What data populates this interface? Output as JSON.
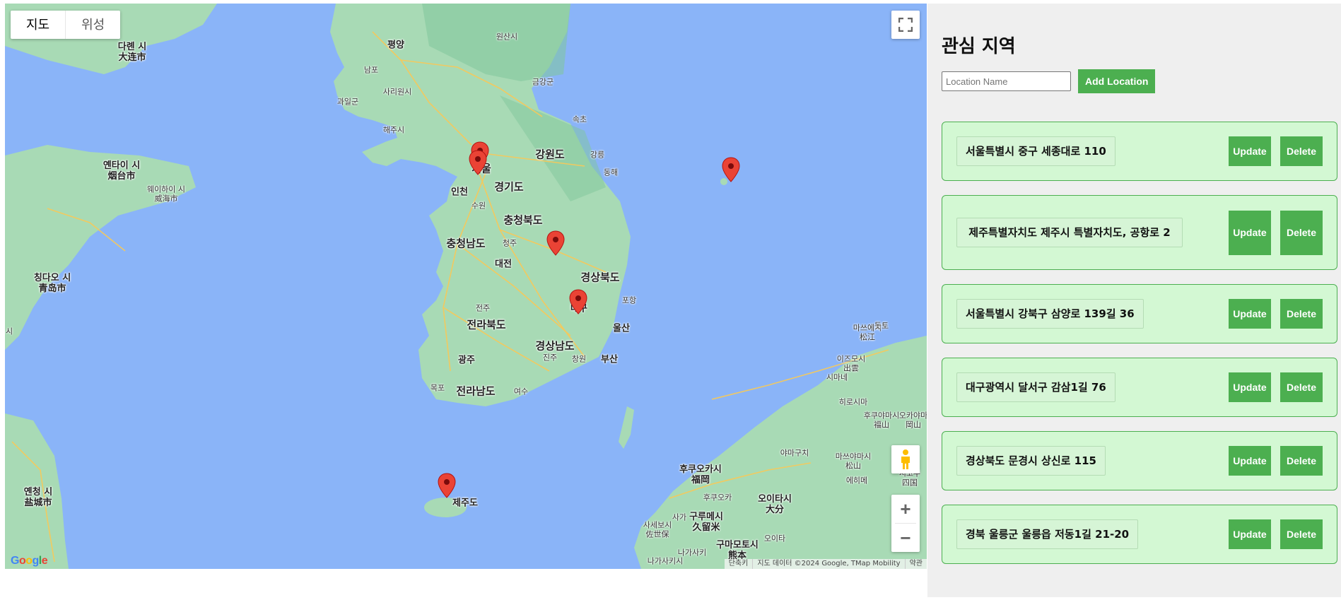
{
  "map": {
    "type_control": {
      "map_label": "지도",
      "satellite_label": "위성"
    },
    "places": [
      {
        "id": "pyongyang",
        "name": "평양"
      },
      {
        "id": "gangwon",
        "name": "강원도"
      },
      {
        "id": "gyeonggi",
        "name": "경기도"
      },
      {
        "id": "incheon",
        "name": "인천"
      },
      {
        "id": "suwon",
        "name": "수원"
      },
      {
        "id": "chungbuk",
        "name": "충청북도"
      },
      {
        "id": "chungnam",
        "name": "충청남도"
      },
      {
        "id": "cheongju",
        "name": "청주"
      },
      {
        "id": "daejeon",
        "name": "대전"
      },
      {
        "id": "gyeongbuk",
        "name": "경상북도"
      },
      {
        "id": "pohang",
        "name": "포항"
      },
      {
        "id": "jeonju",
        "name": "전주"
      },
      {
        "id": "jeonbuk",
        "name": "전라북도"
      },
      {
        "id": "ulsan",
        "name": "울산"
      },
      {
        "id": "gyeongnam",
        "name": "경상남도"
      },
      {
        "id": "jinju",
        "name": "진주"
      },
      {
        "id": "changwon",
        "name": "창원"
      },
      {
        "id": "busan",
        "name": "부산"
      },
      {
        "id": "gwangju",
        "name": "광주"
      },
      {
        "id": "mokpo",
        "name": "목포"
      },
      {
        "id": "jeonnam",
        "name": "전라남도"
      },
      {
        "id": "yeosu",
        "name": "여수"
      },
      {
        "id": "jeju",
        "name": "제주도"
      },
      {
        "id": "namp",
        "name": "남포"
      },
      {
        "id": "sariwon",
        "name": "사리원시"
      },
      {
        "id": "gwail",
        "name": "과일군"
      },
      {
        "id": "haeju",
        "name": "해주시"
      },
      {
        "id": "wonsan",
        "name": "원산시"
      },
      {
        "id": "geumgang",
        "name": "금강군"
      },
      {
        "id": "sokcho",
        "name": "속초"
      },
      {
        "id": "gangneung",
        "name": "강릉"
      },
      {
        "id": "donghae",
        "name": "동해"
      },
      {
        "id": "dalian",
        "name": "다롄 시\n大连市"
      },
      {
        "id": "yantai",
        "name": "옌타이 시\n烟台市"
      },
      {
        "id": "weihai",
        "name": "웨이하이 시\n威海市"
      },
      {
        "id": "qingdao",
        "name": "칭다오 시\n青岛市"
      },
      {
        "id": "yancheng",
        "name": "옌청 시\n盐城市"
      },
      {
        "id": "matsue",
        "name": "마쓰에시\n松江"
      },
      {
        "id": "izumo",
        "name": "이즈모시\n出雲"
      },
      {
        "id": "shimane",
        "name": "시마네"
      },
      {
        "id": "hiroshima",
        "name": "히로시마"
      },
      {
        "id": "fukuyama",
        "name": "후쿠야마시\n福山"
      },
      {
        "id": "okayama",
        "name": "오카야마\n岡山"
      },
      {
        "id": "yamaguchi",
        "name": "야마구치"
      },
      {
        "id": "matsuyama",
        "name": "마쓰야마시\n松山"
      },
      {
        "id": "ehime",
        "name": "에히메"
      },
      {
        "id": "shikoku",
        "name": "시코쿠\n四国"
      },
      {
        "id": "fukuoka",
        "name": "후쿠오카시\n福岡"
      },
      {
        "id": "fukuokaken",
        "name": "후쿠오카"
      },
      {
        "id": "kurume",
        "name": "구루메시\n久留米"
      },
      {
        "id": "sasebo",
        "name": "사세보시\n佐世保"
      },
      {
        "id": "oita",
        "name": "오이타시\n大分"
      },
      {
        "id": "kumamoto",
        "name": "구마모토시\n熊本"
      },
      {
        "id": "nagasaki",
        "name": "나가사키시"
      },
      {
        "id": "tottori",
        "name": "돗토"
      },
      {
        "id": "saga",
        "name": "사가"
      },
      {
        "id": "oitaken",
        "name": "오이타"
      },
      {
        "id": "nagasakiken",
        "name": "나가사키"
      },
      {
        "id": "daegu",
        "name": "대구"
      },
      {
        "id": "seoul",
        "name": "서울"
      },
      {
        "id": "si",
        "name": "시"
      }
    ],
    "markers": [
      {
        "name": "seoul-marker-1"
      },
      {
        "name": "seoul-marker-2"
      },
      {
        "name": "ulleung-marker"
      },
      {
        "name": "mungyeong-marker"
      },
      {
        "name": "daegu-marker"
      },
      {
        "name": "jeju-marker"
      }
    ],
    "attribution": {
      "shortcuts": "단축키",
      "data": "지도 데이터 ©2024 Google, TMap Mobility",
      "terms": "약관"
    },
    "logo": "Google",
    "zoom_in": "+",
    "zoom_out": "−"
  },
  "panel": {
    "title": "관심 지역",
    "input_placeholder": "Location Name",
    "add_button": "Add Location",
    "locations": [
      {
        "address": "서울특별시 중구 세종대로 110",
        "update": "Update",
        "delete": "Delete"
      },
      {
        "address": "제주특별자치도 제주시 특별자치도, 공항로 2",
        "update": "Update",
        "delete": "Delete"
      },
      {
        "address": "서울특별시 강북구 삼양로 139길 36",
        "update": "Update",
        "delete": "Delete"
      },
      {
        "address": "대구광역시 달서구 감삼1길 76",
        "update": "Update",
        "delete": "Delete"
      },
      {
        "address": "경상북도 문경시 상신로 115",
        "update": "Update",
        "delete": "Delete"
      },
      {
        "address": "경북 울릉군 울릉읍 저동1길 21-20",
        "update": "Update",
        "delete": "Delete"
      }
    ]
  },
  "colors": {
    "water": "#8ab4f8",
    "land": "#a8dab5",
    "land_light": "#d4ebc8",
    "road": "#f6c95b",
    "marker": "#ea4335",
    "button": "#4caf50",
    "card_bg": "#d3f8d3",
    "panel_bg": "#efefef"
  }
}
